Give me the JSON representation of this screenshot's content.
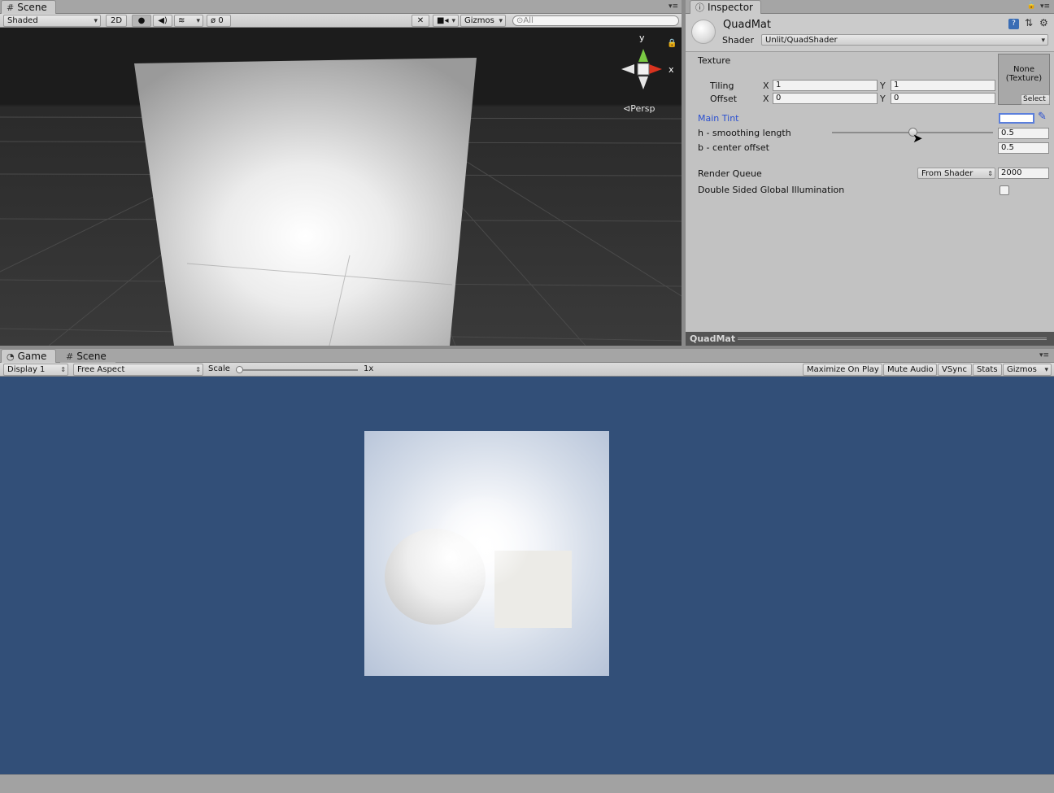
{
  "scene_panel": {
    "tab_label": "Scene",
    "shading_mode": "Shaded",
    "mode_2d_label": "2D",
    "hidden_count": "0",
    "gizmos_label": "Gizmos",
    "search_placeholder": "All",
    "projection_label": "Persp",
    "axis_y": "y",
    "axis_x": "x"
  },
  "inspector": {
    "tab_label": "Inspector",
    "material_name": "QuadMat",
    "shader_label": "Shader",
    "shader_value": "Unlit/QuadShader",
    "texture_label": "Texture",
    "texture_slot": "None\n(Texture)",
    "texture_select": "Select",
    "tiling_label": "Tiling",
    "tiling_x": "1",
    "tiling_y": "1",
    "offset_label": "Offset",
    "offset_x": "0",
    "offset_y": "0",
    "x_label": "X",
    "y_label": "Y",
    "main_tint_label": "Main Tint",
    "smoothing_label": "h - smoothing length",
    "smoothing_value": "0.5",
    "smoothing_fraction": 0.5,
    "center_offset_label": "b - center offset",
    "center_offset_value": "0.5",
    "render_queue_label": "Render Queue",
    "render_queue_mode": "From Shader",
    "render_queue_value": "2000",
    "double_sided_label": "Double Sided Global Illumination",
    "double_sided_checked": false,
    "preview_title": "QuadMat"
  },
  "game_panel": {
    "tab_game": "Game",
    "tab_scene": "Scene",
    "display": "Display 1",
    "aspect": "Free Aspect",
    "scale_label": "Scale",
    "scale_value": "1x",
    "maximize_on_play": "Maximize On Play",
    "mute_audio": "Mute Audio",
    "vsync": "VSync",
    "stats": "Stats",
    "gizmos": "Gizmos"
  },
  "colors": {
    "game_background": "#324f78",
    "scene_background": "#1c1c1c",
    "main_tint_text": "#2a4fd0",
    "inspector_background": "#c2c2c2"
  }
}
